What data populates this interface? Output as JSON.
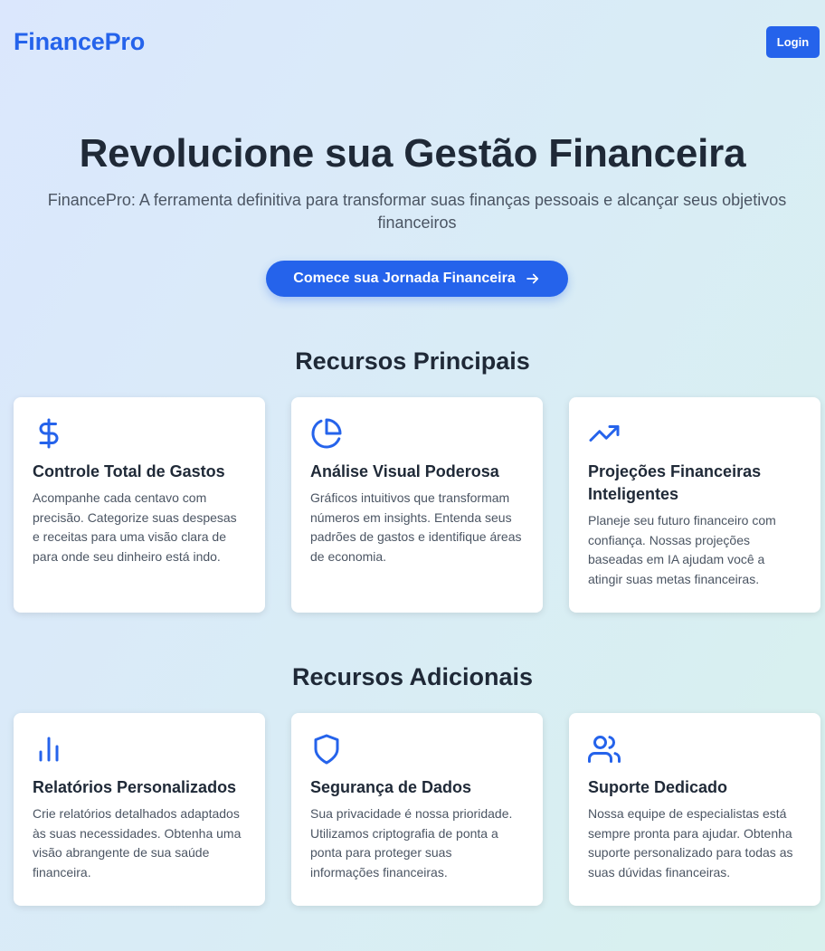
{
  "header": {
    "logo": "FinancePro",
    "login_label": "Login"
  },
  "hero": {
    "title": "Revolucione sua Gestão Financeira",
    "subtitle": "FinancePro: A ferramenta definitiva para transformar suas finanças pessoais e alcançar seus objetivos financeiros",
    "cta_label": "Comece sua Jornada Financeira"
  },
  "main_features": {
    "title": "Recursos Principais",
    "cards": [
      {
        "icon": "dollar-icon",
        "title": "Controle Total de Gastos",
        "text": "Acompanhe cada centavo com precisão. Categorize suas despesas e receitas para uma visão clara de para onde seu dinheiro está indo."
      },
      {
        "icon": "pie-chart-icon",
        "title": "Análise Visual Poderosa",
        "text": "Gráficos intuitivos que transformam números em insights. Entenda seus padrões de gastos e identifique áreas de economia."
      },
      {
        "icon": "trending-up-icon",
        "title": "Projeções Financeiras Inteligentes",
        "text": "Planeje seu futuro financeiro com confiança. Nossas projeções baseadas em IA ajudam você a atingir suas metas financeiras."
      }
    ]
  },
  "additional_features": {
    "title": "Recursos Adicionais",
    "cards": [
      {
        "icon": "bar-chart-icon",
        "title": "Relatórios Personalizados",
        "text": "Crie relatórios detalhados adaptados às suas necessidades. Obtenha uma visão abrangente de sua saúde financeira."
      },
      {
        "icon": "shield-icon",
        "title": "Segurança de Dados",
        "text": "Sua privacidade é nossa prioridade. Utilizamos criptografia de ponta a ponta para proteger suas informações financeiras."
      },
      {
        "icon": "users-icon",
        "title": "Suporte Dedicado",
        "text": "Nossa equipe de especialistas está sempre pronta para ajudar. Obtenha suporte personalizado para todas as suas dúvidas financeiras."
      }
    ]
  },
  "colors": {
    "accent": "#2563eb",
    "heading": "#1f2937",
    "body_text": "#4b5563",
    "card_bg": "#ffffff"
  }
}
